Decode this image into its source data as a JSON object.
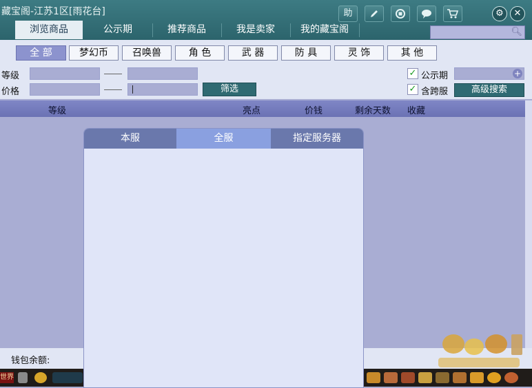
{
  "window": {
    "title": "藏宝阁-江苏1区[雨花台]",
    "help_label": "助"
  },
  "tabs": [
    {
      "label": "浏览商品",
      "active": true
    },
    {
      "label": "公示期",
      "active": false
    },
    {
      "label": "推荐商品",
      "active": false
    },
    {
      "label": "我是卖家",
      "active": false
    },
    {
      "label": "我的藏宝阁",
      "active": false
    }
  ],
  "search": {
    "placeholder": ""
  },
  "categories": [
    {
      "label": "全 部",
      "active": true
    },
    {
      "label": "梦幻币",
      "active": false
    },
    {
      "label": "召唤兽",
      "active": false
    },
    {
      "label": "角 色",
      "active": false
    },
    {
      "label": "武 器",
      "active": false
    },
    {
      "label": "防 具",
      "active": false
    },
    {
      "label": "灵 饰",
      "active": false
    },
    {
      "label": "其 他",
      "active": false
    }
  ],
  "filters": {
    "level_label": "等级",
    "price_label": "价格",
    "filter_button": "筛选",
    "public_period_label": "公示期",
    "public_period_checked": true,
    "cross_server_label": "含跨服",
    "cross_server_checked": true,
    "advanced_search_button": "高级搜索"
  },
  "table": {
    "columns": [
      "等级",
      "亮点",
      "价钱",
      "剩余天数",
      "收藏"
    ],
    "rows": []
  },
  "footer": {
    "wallet_label": "钱包余额:"
  },
  "taskbar": {
    "world_label": "世界"
  },
  "server_modal": {
    "tabs": [
      {
        "label": "本服",
        "active": false
      },
      {
        "label": "全服",
        "active": true
      },
      {
        "label": "指定服务器",
        "active": false
      }
    ]
  },
  "colors": {
    "title_bar": "#2f6a72",
    "accent": "#8c93ce",
    "check": "#1a9a22"
  }
}
